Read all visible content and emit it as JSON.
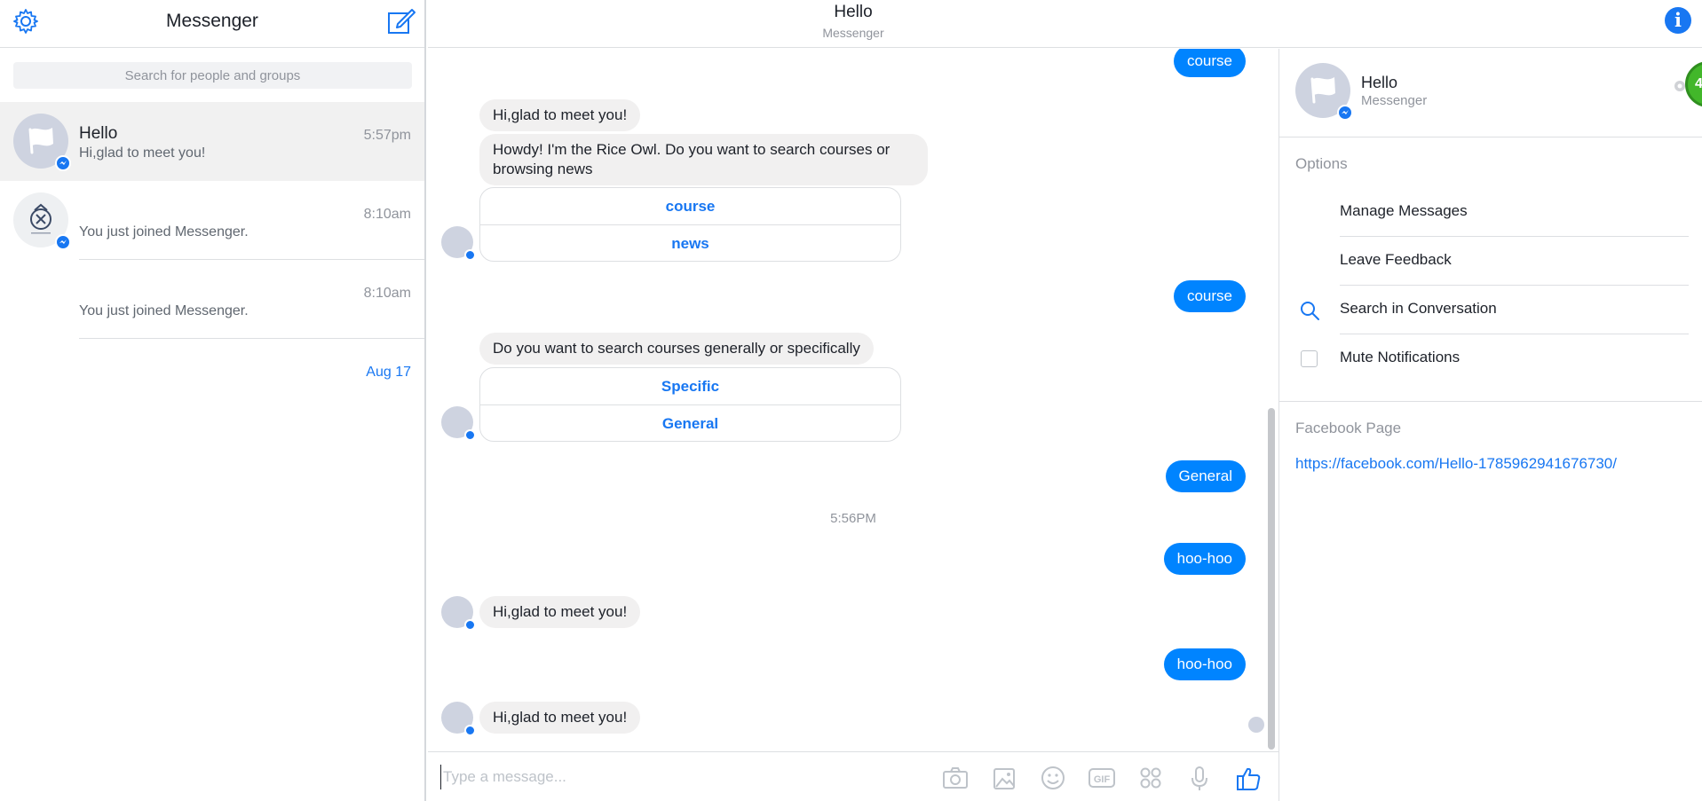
{
  "app": {
    "title": "Messenger",
    "accent": "#0084ff",
    "link_color": "#1877f2"
  },
  "left": {
    "search_placeholder": "Search for people and groups",
    "icons": {
      "settings": "gear-icon",
      "compose": "new-message-icon"
    },
    "conversations": [
      {
        "name": "Hello",
        "snippet": "Hi,glad to meet you!",
        "time": "5:57pm",
        "active": true
      },
      {
        "name": "",
        "snippet": "You just joined Messenger.",
        "time": "8:10am",
        "active": false
      },
      {
        "name": "",
        "snippet": "You just joined Messenger.",
        "time": "8:10am",
        "active": false
      },
      {
        "name": "",
        "snippet": "",
        "time": "Aug 17",
        "active": false
      }
    ]
  },
  "chat": {
    "title": "Hello",
    "subtitle": "Messenger",
    "messages": {
      "out_1": "course",
      "in_1": "Hi,glad to meet you!",
      "in_2": "Howdy! I'm the Rice Owl. Do you want to search courses or browsing news",
      "qr_1": [
        "course",
        "news"
      ],
      "out_2": "course",
      "in_3": "Do you want to search courses generally or specifically",
      "qr_2": [
        "Specific",
        "General"
      ],
      "out_3": "General",
      "timestamp": "5:56PM",
      "out_4": "hoo-hoo",
      "in_4": "Hi,glad to meet you!",
      "out_5": "hoo-hoo",
      "in_5": "Hi,glad to meet you!"
    },
    "composer_placeholder": "Type a message...",
    "toolbar_icons": [
      "camera-icon",
      "photo-icon",
      "emoji-icon",
      "gif-icon",
      "apps-icon",
      "microphone-icon",
      "thumbs-up-icon"
    ]
  },
  "right": {
    "name": "Hello",
    "subtitle": "Messenger",
    "options_title": "Options",
    "options": [
      "Manage Messages",
      "Leave Feedback",
      "Search in Conversation",
      "Mute Notifications"
    ],
    "page_title": "Facebook Page",
    "page_link": "https://facebook.com/Hello-1785962941676730/"
  }
}
